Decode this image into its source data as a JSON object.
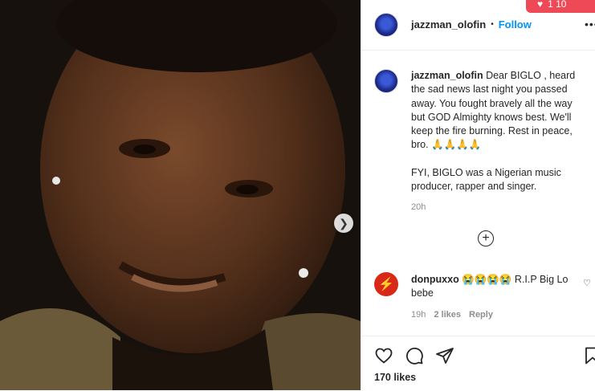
{
  "post": {
    "username": "jazzman_olofin",
    "follow_sep": "•",
    "follow_label": "Follow",
    "more_label": "•••",
    "caption_user": "jazzman_olofin",
    "caption_text": "Dear BIGLO , heard the sad news last night you passed away. You fought bravely all the way but GOD Almighty knows best. We'll keep the fire burning. Rest in peace, bro. 🙏🙏🙏🙏",
    "caption_text2": "FYI, BIGLO was a Nigerian music producer, rapper and singer.",
    "time": "20h",
    "load_more": "+",
    "likes": "170 likes"
  },
  "comment": {
    "username": "donpuxxo",
    "text": "😭😭😭😭 R.I.P Big Lo bebe",
    "time": "19h",
    "likes": "2 likes",
    "reply": "Reply"
  },
  "notification": {
    "text": "1  10"
  },
  "icons": {
    "next": "chevron-right-icon",
    "like": "heart-icon",
    "comment": "comment-icon",
    "share": "paper-plane-icon",
    "save": "bookmark-icon",
    "comment_like": "heart-icon"
  },
  "colors": {
    "link": "#0095f6",
    "muted": "#8e8e8e",
    "notification": "#ed4956"
  }
}
